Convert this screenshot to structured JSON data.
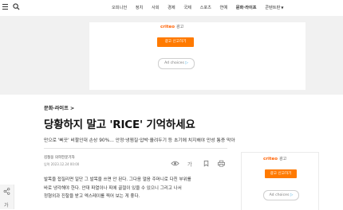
{
  "nav": {
    "items": [
      "오피니언",
      "정치",
      "사회",
      "경제",
      "국제",
      "스포츠",
      "연예",
      "문화·라이프",
      "콘텐트판"
    ],
    "active_index": 7
  },
  "ad_top": {
    "brand": "criteo",
    "label": "광고",
    "button": "광고 신고하기",
    "choices": "Ad choices"
  },
  "ad_side": {
    "brand": "criteo",
    "label": "광고",
    "button": "광고 신고하기",
    "choices": "Ad choices"
  },
  "article": {
    "breadcrumb": "문화·라이프 >",
    "headline": "당황하지 말고 'RICE' 기억하세요",
    "subheadline": "만으로 '삐끗' 비팔인대 손상 90%… 안정·냉찜질·압박·올려두기 등 초기에 치지해야 만성 통증 막아",
    "byline": "김철웅 의학전문기자",
    "dateline": "입력 2023.12.24 00:00",
    "body": [
      "발목을 접질리면 일단 그 발목을 쓰면 안 된다. 그다음 얼음 주머니로 다친 부위를",
      "바로 냉각해야 한다. 안대 파열이나 피에 골절이 있을 수 있으니 그리고 나서",
      "정형외과 진찰을 받고 엑스레이를 찍어 보는 게 좋다."
    ]
  },
  "left_rail": {
    "font_button": "가"
  }
}
